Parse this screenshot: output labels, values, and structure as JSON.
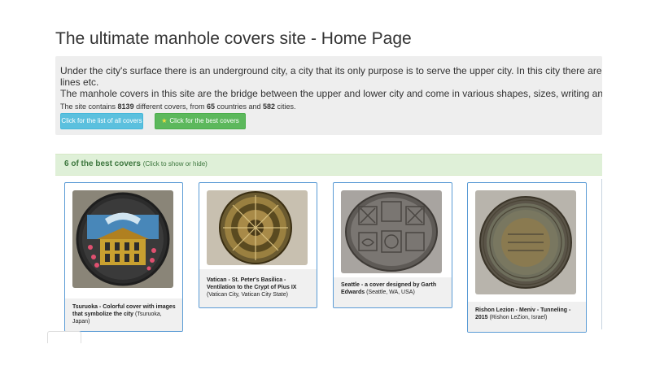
{
  "page": {
    "title": "The ultimate manhole covers site - Home Page"
  },
  "intro": {
    "line1": "Under the city's surface there is an underground city, a city that its only purpose is to serve the upper city. In this city there are",
    "line2": "lines etc.",
    "line3": "The manhole covers in this site are the bridge between the upper and lower city and come in various shapes, sizes, writing an",
    "stats_prefix": "The site contains ",
    "covers_count": "8139",
    "stats_mid1": " different covers, from ",
    "countries_count": "65",
    "stats_mid2": " countries and ",
    "cities_count": "582",
    "stats_suffix": " cities."
  },
  "buttons": {
    "list_label": "Click for the list of all covers",
    "best_label": "Click for the best covers"
  },
  "best_section": {
    "title": "6 of the best covers",
    "hint": "(Click to show or hide)"
  },
  "covers": [
    {
      "title": "Tsuruoka - Colorful cover with images that symbolize the city",
      "location": "(Tsuruoka, Japan)"
    },
    {
      "title": "Vatican - St. Peter's Basilica - Ventilation to the Crypt of Pius IX",
      "location": "(Vatican City, Vatican City State)"
    },
    {
      "title": "Seattle - a cover designed by Garth Edwards",
      "location": "(Seattle, WA, USA)"
    },
    {
      "title": "Rishon Lezion - Meniv - Tunneling - 2015",
      "location": "(Rishon LeZion, Israel)"
    }
  ],
  "colors": {
    "info_button": "#5bc0de",
    "success_button": "#5cb85c",
    "panel_heading_bg": "#dff0d8",
    "panel_heading_text": "#3c763d",
    "card_border": "#5a9bd5"
  }
}
